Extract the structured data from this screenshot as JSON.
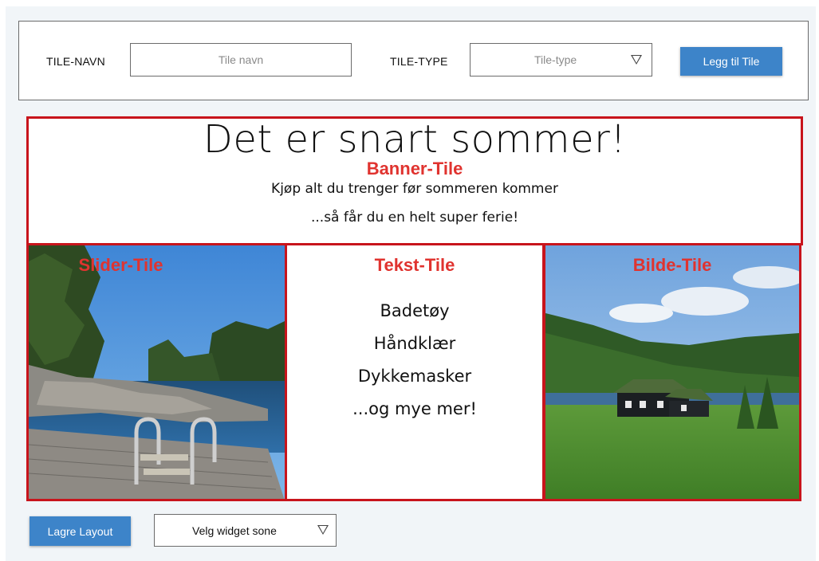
{
  "form": {
    "tile_name_label": "TILE-NAVN",
    "tile_name_placeholder": "Tile navn",
    "tile_type_label": "TILE-TYPE",
    "tile_type_value": "Tile-type",
    "add_button": "Legg til Tile"
  },
  "banner": {
    "tag": "Banner-Tile",
    "title": "Det er snart sommer!",
    "line1": "Kjøp alt du trenger før sommeren kommer",
    "line2": "...så får du en helt super ferie!"
  },
  "slider": {
    "tag": "Slider-Tile"
  },
  "text_tile": {
    "tag": "Tekst-Tile",
    "items": [
      "Badetøy",
      "Håndklær",
      "Dykkemasker",
      "...og mye mer!"
    ]
  },
  "image_tile": {
    "tag": "Bilde-Tile"
  },
  "footer": {
    "save_button": "Lagre Layout",
    "zone_select": "Velg widget sone"
  },
  "colors": {
    "accent": "#3d84c9",
    "tile_border": "#c8141c",
    "tag": "#e0332f"
  }
}
